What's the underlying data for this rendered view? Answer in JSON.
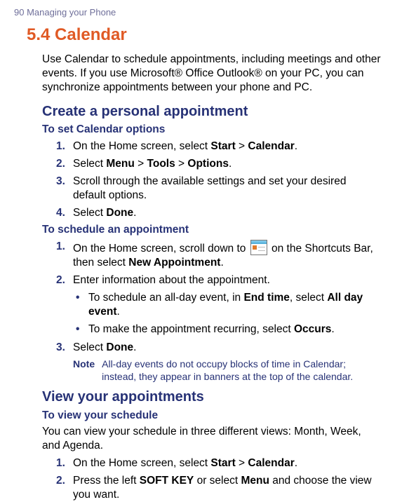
{
  "running_head": "90  Managing your Phone",
  "section_title": "5.4 Calendar",
  "intro": "Use Calendar to schedule appointments, including meetings and other events. If you use Microsoft® Office Outlook® on your PC, you can synchronize appointments between your phone and PC.",
  "create": {
    "heading": "Create a personal appointment",
    "set_options": {
      "heading": "To set Calendar options",
      "steps": {
        "s1": {
          "num": "1.",
          "pre": "On the Home screen, select ",
          "b1": "Start",
          "mid": " > ",
          "b2": "Calendar",
          "post": "."
        },
        "s2": {
          "num": "2.",
          "pre": "Select ",
          "b1": "Menu",
          "m1": " > ",
          "b2": "Tools",
          "m2": " > ",
          "b3": "Options",
          "post": "."
        },
        "s3": {
          "num": "3.",
          "text": "Scroll through the available settings and set your desired default options."
        },
        "s4": {
          "num": "4.",
          "pre": "Select ",
          "b1": "Done",
          "post": "."
        }
      }
    },
    "schedule": {
      "heading": "To schedule an appointment",
      "steps": {
        "s1": {
          "num": "1.",
          "pre": "On the Home screen, scroll down to ",
          "post_icon": " on the Shortcuts Bar, then select ",
          "b1": "New Appointment",
          "post": "."
        },
        "s2": {
          "num": "2.",
          "text": "Enter information about the appointment."
        },
        "s3": {
          "num": "3.",
          "pre": "Select ",
          "b1": "Done",
          "post": "."
        }
      },
      "bullets": {
        "b1": {
          "pre": "To schedule an all-day event, in ",
          "b1": "End time",
          "mid": ", select ",
          "b2": "All day event",
          "post": "."
        },
        "b2": {
          "pre": "To make the appointment recurring, select ",
          "b1": "Occurs",
          "post": "."
        }
      },
      "note": {
        "label": "Note",
        "body": "All-day events do not occupy blocks of time in Calendar; instead, they appear in banners at the top of the calendar."
      }
    }
  },
  "view": {
    "heading": "View your appointments",
    "sub": {
      "heading": "To view your schedule",
      "para": "You can view your schedule in three different views: Month, Week, and Agenda.",
      "steps": {
        "s1": {
          "num": "1.",
          "pre": "On the Home screen, select ",
          "b1": "Start",
          "mid": " > ",
          "b2": "Calendar",
          "post": "."
        },
        "s2": {
          "num": "2.",
          "pre": "Press the left ",
          "b1": "SOFT KEY",
          "mid": " or select ",
          "b2": "Menu",
          "post": " and choose the view you want."
        }
      }
    }
  }
}
